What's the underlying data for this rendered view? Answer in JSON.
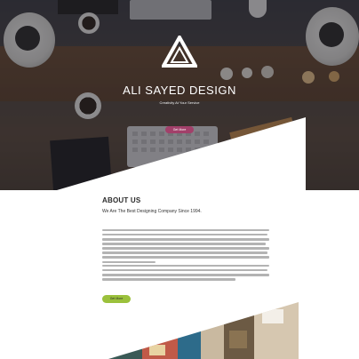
{
  "hero": {
    "title": "ALI SAYED DESIGN",
    "subtitle": "Creativity At Your Service",
    "button_label": "Get More"
  },
  "about": {
    "heading": "ABOUT US",
    "subheading": "We Are The Best Designing Company Since 1994.",
    "button_label": "Get More"
  },
  "colors": {
    "hero_button": "#a2406a",
    "about_button": "#9bc13c",
    "heading": "#2b2b2b"
  }
}
